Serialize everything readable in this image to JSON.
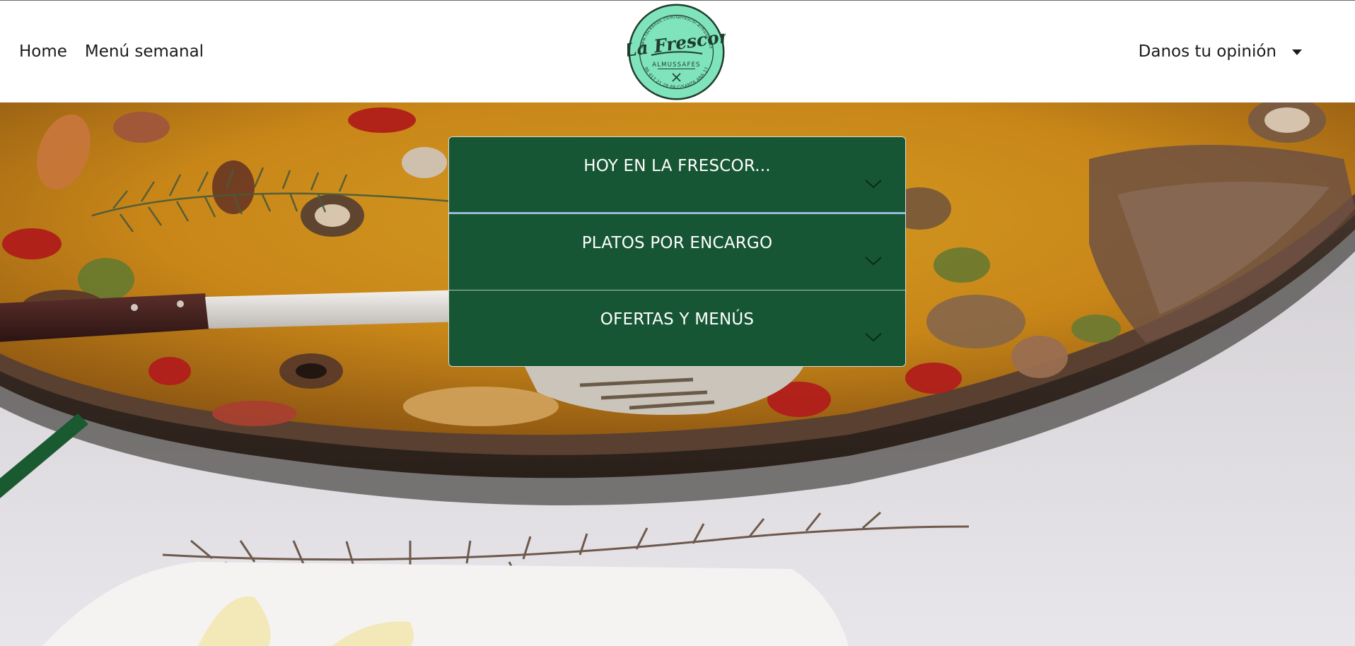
{
  "navbar": {
    "links": [
      {
        "label": "Home"
      },
      {
        "label": "Menú semanal"
      }
    ],
    "dropdown": {
      "label": "Danos tu opinión",
      "icon": "caret-down-icon"
    },
    "logo": {
      "brand": "La Frescor",
      "location": "ALMUSSAFES",
      "icon": "fork-knife-icon",
      "ring_text": "www.facebook.com/lafrescor.almussafes",
      "ring_bottom": "96 417 21 28 89 C/SANTA ANA 17",
      "color": "#7fe3bb"
    }
  },
  "accordion": {
    "items": [
      {
        "title": "HOY EN LA FRESCOR...",
        "icon": "chevron-down-icon"
      },
      {
        "title": "PLATOS POR ENCARGO",
        "icon": "chevron-down-icon"
      },
      {
        "title": "OFERTAS Y MENÚS",
        "icon": "chevron-down-icon"
      }
    ],
    "color": "#175634"
  },
  "hero": {
    "image": "paella-pan-photo"
  }
}
